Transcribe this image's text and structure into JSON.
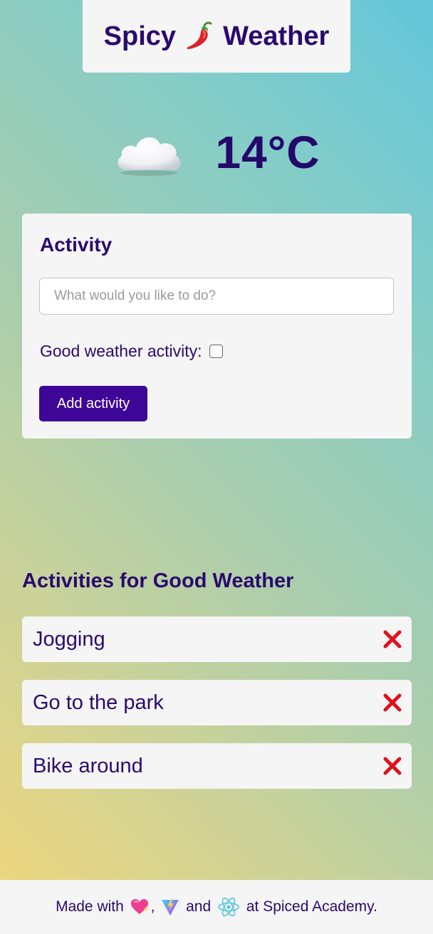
{
  "header": {
    "title_part1": "Spicy",
    "title_part2": "Weather",
    "title_icon": "chili-pepper-icon"
  },
  "weather": {
    "condition_icon": "cloud-icon",
    "temperature": "14°C"
  },
  "form": {
    "heading": "Activity",
    "input_placeholder": "What would you like to do?",
    "input_value": "",
    "checkbox_label": "Good weather activity:",
    "checkbox_checked": false,
    "submit_label": "Add activity"
  },
  "activities": {
    "heading": "Activities for Good Weather",
    "items": [
      {
        "label": "Jogging"
      },
      {
        "label": "Go to the park"
      },
      {
        "label": "Bike around"
      }
    ],
    "delete_icon": "cross-icon",
    "delete_color": "#e0111b"
  },
  "footer": {
    "text_before": "Made with ",
    "sep1": ", ",
    "sep2": " and ",
    "text_after": " at Spiced Academy.",
    "icons": [
      "sparkling-heart-icon",
      "vite-logo-icon",
      "react-logo-icon"
    ]
  },
  "colors": {
    "primary_text": "#2a0a6e",
    "button": "#3e0697",
    "card": "#f5f5f5"
  }
}
